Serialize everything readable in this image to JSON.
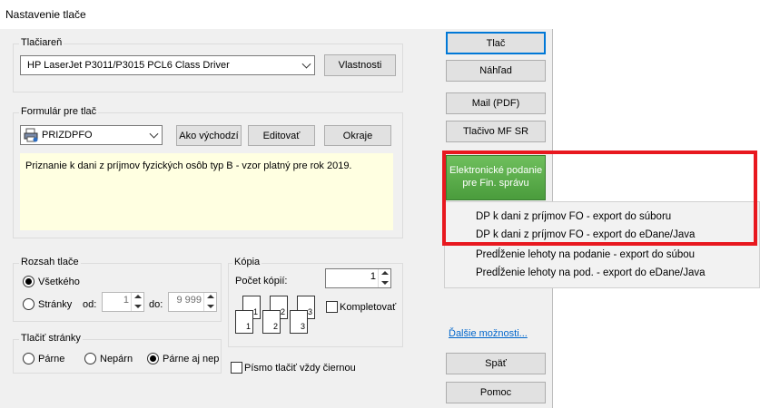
{
  "window": {
    "title": "Nastavenie tlače"
  },
  "printer": {
    "group_label": "Tlačiareň",
    "selected": "HP LaserJet P3011/P3015 PCL6 Class Driver",
    "properties_button": "Vlastnosti"
  },
  "form": {
    "group_label": "Formulár pre tlač",
    "selected": "PRIZDPFO",
    "default_button": "Ako východzí",
    "edit_button": "Editovať",
    "margins_button": "Okraje",
    "description": "Priznanie k dani z príjmov fyzických osôb typ B - vzor platný pre rok 2019."
  },
  "range": {
    "group_label": "Rozsah tlače",
    "all_label": "Všetkého",
    "pages_label": "Stránky",
    "from_label": "od:",
    "from_value": "1",
    "to_label": "do:",
    "to_value": "9 999"
  },
  "copies": {
    "group_label": "Kópia",
    "count_label": "Počet kópií:",
    "count_value": "1",
    "collate_label": "Kompletovať",
    "page_numbers": [
      "1",
      "1",
      "2",
      "2",
      "3",
      "3"
    ]
  },
  "print_pages": {
    "group_label": "Tlačiť stránky",
    "even_label": "Párne",
    "odd_label": "Nepárn",
    "both_label": "Párne aj nep"
  },
  "black_font_label": "Písmo tlačiť vždy čiernou",
  "buttons": {
    "print": "Tlač",
    "preview": "Náhľad",
    "mail": "Mail (PDF)",
    "mf_form": "Tlačivo MF SR",
    "efiling": "Elektronické podanie pre Fin. správu",
    "back": "Späť",
    "help": "Pomoc"
  },
  "efiling_menu": {
    "items": [
      "DP k dani z príjmov FO - export do súboru",
      "DP k dani z príjmov FO - export do eDane/Java",
      "Predĺženie lehoty na podanie -  export do súbou",
      "Predĺženie lehoty na pod. - export do eDane/Java"
    ]
  },
  "more_options_link": "Ďalšie možnosti...",
  "colors": {
    "highlight": "#e8181f",
    "green": "#4a9c3c",
    "link": "#0066cc",
    "yellow": "#ffffe1"
  },
  "icons": {
    "form": "printer-form-icon"
  }
}
